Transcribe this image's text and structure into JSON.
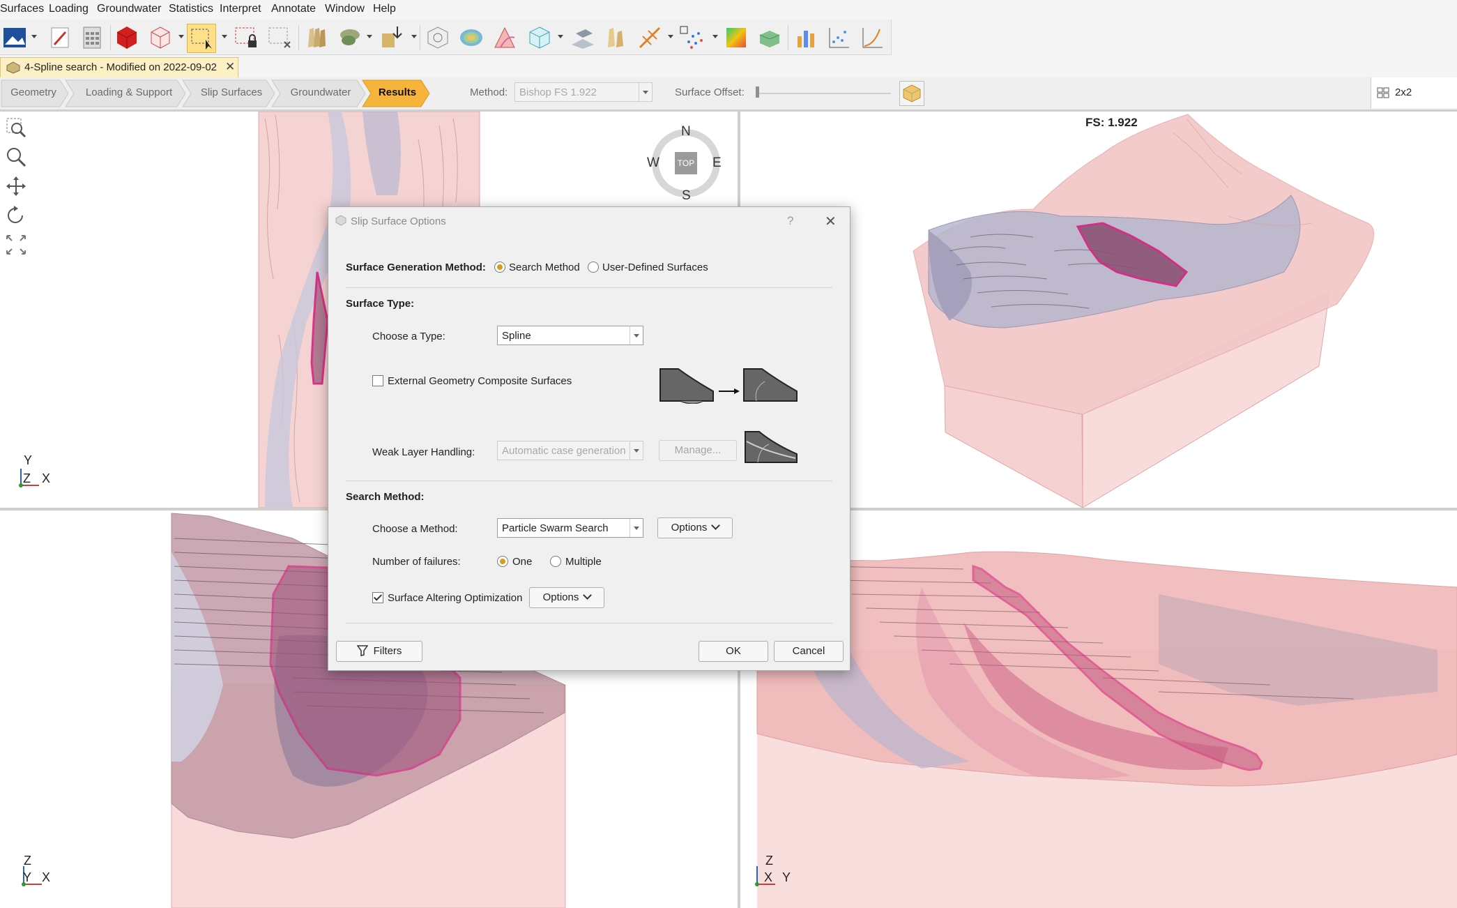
{
  "menu": [
    "Surfaces",
    "Loading",
    "Groundwater",
    "Statistics",
    "Interpret",
    "Annotate",
    "Window",
    "Help"
  ],
  "doc_tab": {
    "title": "4-Spline search - Modified on 2022-09-02"
  },
  "workflow": {
    "steps": [
      "Geometry",
      "Loading & Support",
      "Slip Surfaces",
      "Groundwater",
      "Results"
    ],
    "method_label": "Method:",
    "method_value": "Bishop FS    1.922",
    "surface_offset_label": "Surface Offset:",
    "layout_label": "2x2"
  },
  "compass": {
    "n": "N",
    "s": "S",
    "e": "E",
    "w": "W",
    "center": "TOP"
  },
  "viewports": {
    "top_right_fs": "FS: 1.922",
    "top_left_axes": {
      "v": "Y",
      "h": "X",
      "o": "Z"
    },
    "bottom_left_axes": {
      "v": "Z",
      "h": "X",
      "o": "Y"
    },
    "bottom_right_axes": {
      "v": "Z",
      "h": "Y",
      "o": "X"
    }
  },
  "dialog": {
    "title": "Slip Surface Options",
    "help": "?",
    "surface_gen_label": "Surface Generation Method:",
    "opt_search": "Search Method",
    "opt_user": "User-Defined Surfaces",
    "surface_type_header": "Surface Type:",
    "choose_type_label": "Choose a Type:",
    "type_value": "Spline",
    "external_geom_label": "External Geometry Composite Surfaces",
    "weak_layer_label": "Weak Layer Handling:",
    "weak_layer_value": "Automatic case generation",
    "manage_button": "Manage...",
    "search_method_header": "Search Method:",
    "choose_method_label": "Choose a Method:",
    "method_value": "Particle Swarm Search",
    "options_button": "Options",
    "failures_label": "Number of failures:",
    "opt_one": "One",
    "opt_multiple": "Multiple",
    "surface_altering_label": "Surface Altering Optimization",
    "options_button2": "Options",
    "filters_button": "Filters",
    "ok_button": "OK",
    "cancel_button": "Cancel"
  },
  "colors": {
    "accent": "#f4b942",
    "failure_outline": "#d6187a",
    "soil": "#f4c7c7",
    "layer": "#b9bdd3"
  }
}
